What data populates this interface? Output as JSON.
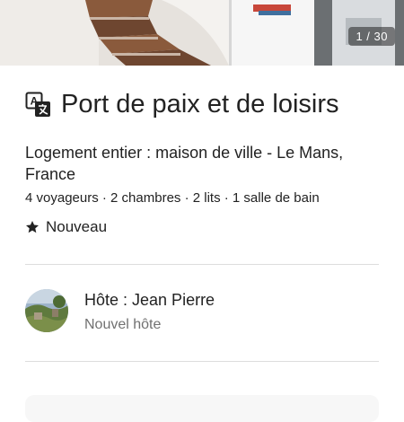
{
  "gallery": {
    "counter": "1 / 30"
  },
  "listing": {
    "title": "Port de paix et de loisirs",
    "subtitle": "Logement entier : maison de ville - Le Mans, France",
    "details": "4 voyageurs · 2 chambres · 2 lits · 1 salle de bain",
    "badge": "Nouveau",
    "translate_icon": "translate-icon",
    "badge_icon": "star-icon"
  },
  "host": {
    "name": "Hôte : Jean Pierre",
    "subtitle": "Nouvel hôte"
  },
  "colors": {
    "text": "#222222",
    "muted": "#717171",
    "divider": "#dddddd"
  }
}
